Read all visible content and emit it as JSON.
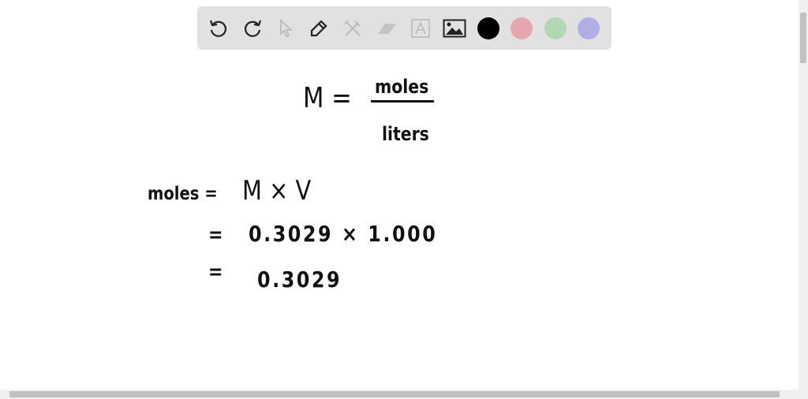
{
  "toolbar": {
    "tools": [
      "undo-icon",
      "redo-icon",
      "select-icon",
      "pen-icon",
      "tools-icon",
      "eraser-icon",
      "text-icon",
      "image-icon"
    ],
    "colors": [
      "#000000",
      "#e6a6ad",
      "#b3d6b3",
      "#b1aee6"
    ]
  },
  "canvas": {
    "formula_lhs": "M =",
    "formula_num": "moles",
    "formula_den": "liters",
    "line1_lhs": "moles =",
    "line1_rhs": "M × V",
    "line2_eq": "=",
    "line2_rhs": "0.3029 × 1.000",
    "line3_eq": "=",
    "line3_rhs": "0.3029"
  }
}
